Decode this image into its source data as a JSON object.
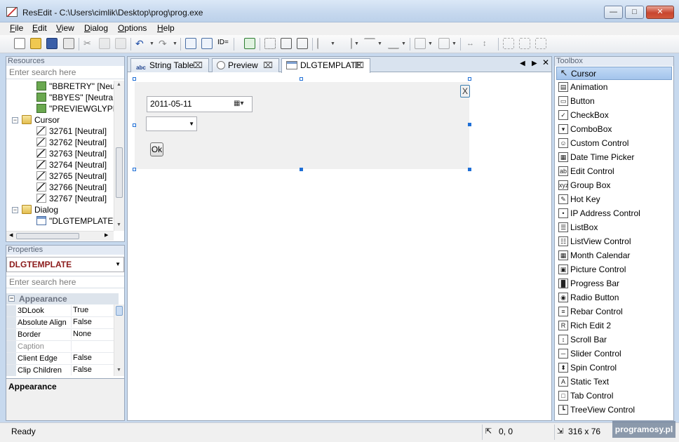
{
  "window": {
    "title": "ResEdit - C:\\Users\\cimlik\\Desktop\\prog\\prog.exe"
  },
  "menu": [
    "File",
    "Edit",
    "View",
    "Dialog",
    "Options",
    "Help"
  ],
  "toolbar": {
    "id_label": "ID="
  },
  "resources": {
    "header": "Resources",
    "search_placeholder": "Enter search here",
    "items": [
      {
        "label": "\"BBRETRY\" [Neutra",
        "icon": "glyph"
      },
      {
        "label": "\"BBYES\" [Neutral]",
        "icon": "glyph"
      },
      {
        "label": "\"PREVIEWGLYPH\" [",
        "icon": "glyph"
      },
      {
        "label": "Cursor",
        "icon": "folder"
      },
      {
        "label": "32761 [Neutral]",
        "icon": "cursor"
      },
      {
        "label": "32762 [Neutral]",
        "icon": "cursor"
      },
      {
        "label": "32763 [Neutral]",
        "icon": "cursor"
      },
      {
        "label": "32764 [Neutral]",
        "icon": "cursor"
      },
      {
        "label": "32765 [Neutral]",
        "icon": "cursor"
      },
      {
        "label": "32766 [Neutral]",
        "icon": "cursor"
      },
      {
        "label": "32767 [Neutral]",
        "icon": "cursor"
      },
      {
        "label": "Dialog",
        "icon": "folder"
      },
      {
        "label": "\"DLGTEMPLATE\" [N",
        "icon": "dialog"
      }
    ]
  },
  "properties": {
    "header": "Properties",
    "object": "DLGTEMPLATE",
    "search_placeholder": "Enter search here",
    "category": "Appearance",
    "rows": [
      {
        "name": "3DLook",
        "value": "True"
      },
      {
        "name": "Absolute Align",
        "value": "False"
      },
      {
        "name": "Border",
        "value": "None"
      },
      {
        "name": "Caption",
        "value": ""
      },
      {
        "name": "Client Edge",
        "value": "False"
      },
      {
        "name": "Clip Children",
        "value": "False"
      }
    ],
    "description_title": "Appearance"
  },
  "tabs": [
    {
      "label": "String Table",
      "icon": "abc"
    },
    {
      "label": "Preview",
      "icon": "magnifier"
    },
    {
      "label": "DLGTEMPLATE",
      "icon": "dialog"
    }
  ],
  "dialog": {
    "date_value": "2011-05-11",
    "ok_label": "Ok",
    "close_glyph": "X"
  },
  "toolbox": {
    "header": "Toolbox",
    "items": [
      "Cursor",
      "Animation",
      "Button",
      "CheckBox",
      "ComboBox",
      "Custom Control",
      "Date Time Picker",
      "Edit Control",
      "Group Box",
      "Hot Key",
      "IP Address Control",
      "ListBox",
      "ListView Control",
      "Month Calendar",
      "Picture Control",
      "Progress Bar",
      "Radio Button",
      "Rebar Control",
      "Rich Edit 2",
      "Scroll Bar",
      "Slider Control",
      "Spin Control",
      "Static Text",
      "Tab Control",
      "TreeView Control"
    ]
  },
  "status": {
    "ready": "Ready",
    "position": "0, 0",
    "size": "316 x 76",
    "watermark": "programosy.pl"
  }
}
